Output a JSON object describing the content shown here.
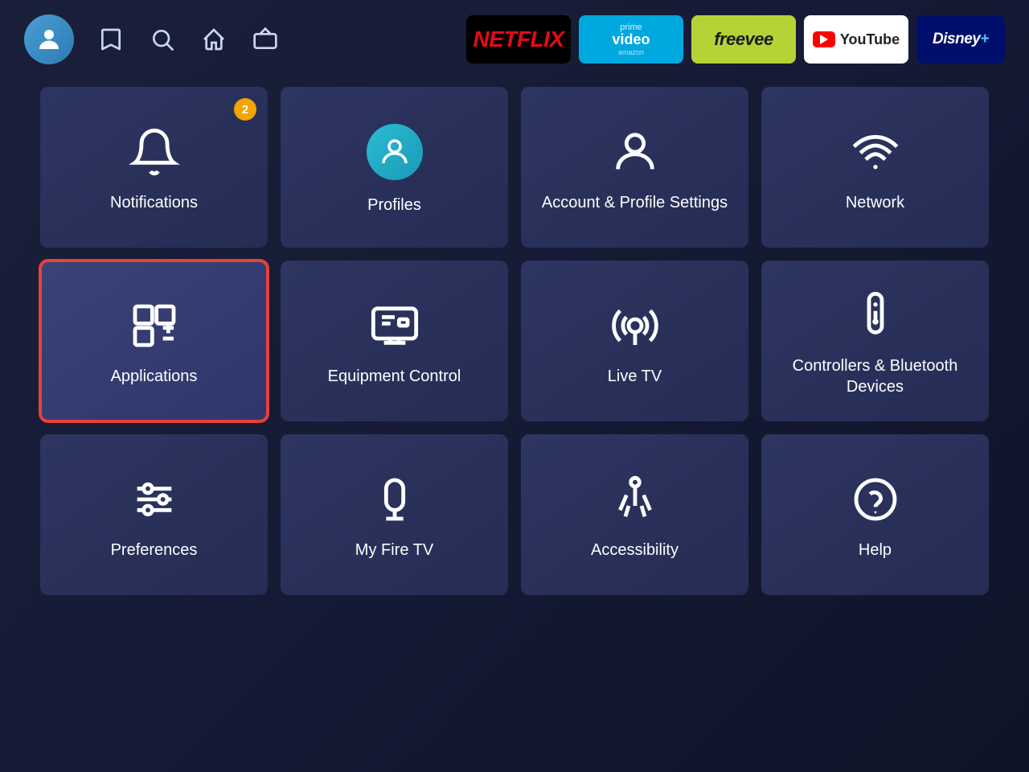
{
  "nav": {
    "bookmark_icon": "bookmark",
    "search_icon": "search",
    "home_icon": "home",
    "tv_icon": "tv"
  },
  "streaming": [
    {
      "id": "netflix",
      "label": "NETFLIX",
      "bg": "#000",
      "text_color": "#E50914"
    },
    {
      "id": "prime",
      "label": "prime video",
      "bg": "#00A8E0"
    },
    {
      "id": "freevee",
      "label": "freevee",
      "bg": "#B5D334"
    },
    {
      "id": "youtube",
      "label": "YouTube",
      "bg": "#fff"
    },
    {
      "id": "disney",
      "label": "Disney+",
      "bg": "#000f6b"
    }
  ],
  "tiles": [
    {
      "id": "notifications",
      "label": "Notifications",
      "badge": "2",
      "row": 1,
      "col": 1
    },
    {
      "id": "profiles",
      "label": "Profiles",
      "row": 1,
      "col": 2
    },
    {
      "id": "account-profile-settings",
      "label": "Account & Profile Settings",
      "row": 1,
      "col": 3
    },
    {
      "id": "network",
      "label": "Network",
      "row": 1,
      "col": 4
    },
    {
      "id": "applications",
      "label": "Applications",
      "selected": true,
      "row": 2,
      "col": 1
    },
    {
      "id": "equipment-control",
      "label": "Equipment Control",
      "row": 2,
      "col": 2
    },
    {
      "id": "live-tv",
      "label": "Live TV",
      "row": 2,
      "col": 3
    },
    {
      "id": "controllers-bluetooth",
      "label": "Controllers & Bluetooth Devices",
      "row": 2,
      "col": 4
    },
    {
      "id": "preferences",
      "label": "Preferences",
      "row": 3,
      "col": 1
    },
    {
      "id": "my-fire-tv",
      "label": "My Fire TV",
      "row": 3,
      "col": 2
    },
    {
      "id": "accessibility",
      "label": "Accessibility",
      "row": 3,
      "col": 3
    },
    {
      "id": "help",
      "label": "Help",
      "row": 3,
      "col": 4
    }
  ]
}
